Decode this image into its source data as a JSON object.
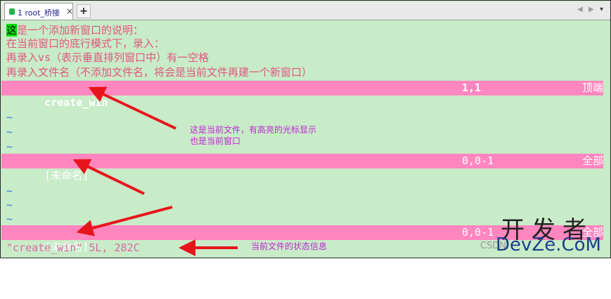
{
  "tab": {
    "label": "1 root_桥接",
    "close": "×",
    "add": "+"
  },
  "nav": {
    "left": "◀",
    "right": "▶",
    "menu": "▾"
  },
  "intro": {
    "first_char": "这",
    "line1_rest": "是一个添加新窗口的说明：",
    "line2": "在当前窗口的底行模式下，录入：",
    "line3": "再录入vs（表示垂直排列窗口中）有一空格",
    "line4": "再录入文件名（不添加文件名，将会是当前文件再建一个新窗口）"
  },
  "window1": {
    "name": "create_win",
    "pos": "1,1",
    "scroll": "顶端"
  },
  "window2": {
    "name": "[未命名]",
    "pos": "0,0-1",
    "scroll": "全部"
  },
  "window3": {
    "name": "[未命名]",
    "pos": "0,0-1",
    "scroll": "全部"
  },
  "tilde": "~",
  "command_line": "\"create_win\" 5L, 282C",
  "annotations": {
    "a1_line1": "这是当前文件，有高亮的光标显示",
    "a1_line2": "也是当前窗口",
    "a2": "当前文件的状态信息"
  },
  "watermark": {
    "big": "开发者",
    "small": "DevZe.CoM",
    "csdn": "CSDN"
  },
  "colors": {
    "background": "#c8ebc8",
    "status_bar": "#ff86bf",
    "text": "#e0587d",
    "cursor": "#00e000",
    "arrow": "#e8141c",
    "annotation": "#c026d3"
  }
}
